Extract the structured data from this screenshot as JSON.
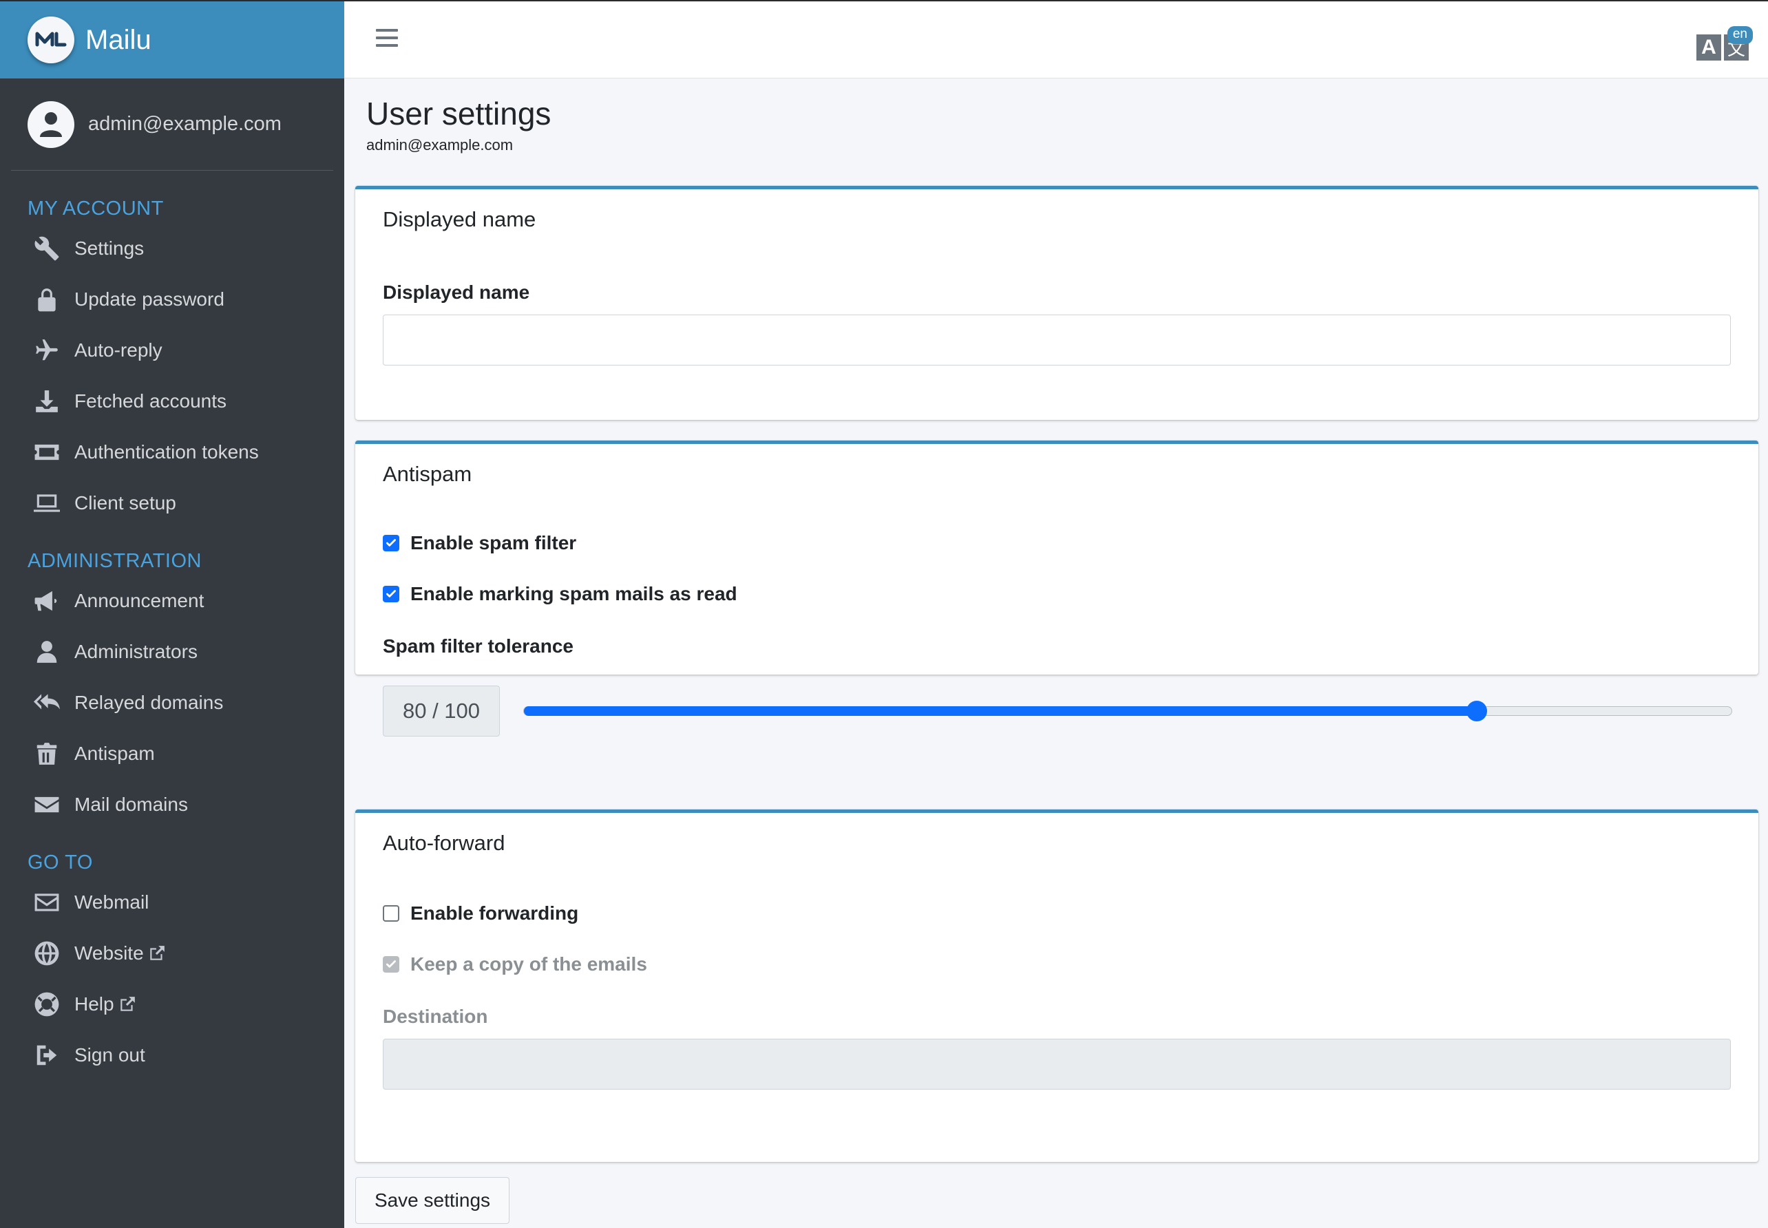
{
  "brand": {
    "name": "Mailu"
  },
  "user": {
    "email": "admin@example.com"
  },
  "sidebar": {
    "sections": [
      {
        "header": "MY ACCOUNT",
        "items": [
          {
            "label": "Settings",
            "icon": "wrench-icon"
          },
          {
            "label": "Update password",
            "icon": "lock-icon"
          },
          {
            "label": "Auto-reply",
            "icon": "plane-icon"
          },
          {
            "label": "Fetched accounts",
            "icon": "download-icon"
          },
          {
            "label": "Authentication tokens",
            "icon": "ticket-icon"
          },
          {
            "label": "Client setup",
            "icon": "laptop-icon"
          }
        ]
      },
      {
        "header": "ADMINISTRATION",
        "items": [
          {
            "label": "Announcement",
            "icon": "bullhorn-icon"
          },
          {
            "label": "Administrators",
            "icon": "user-icon"
          },
          {
            "label": "Relayed domains",
            "icon": "reply-all-icon"
          },
          {
            "label": "Antispam",
            "icon": "trash-icon"
          },
          {
            "label": "Mail domains",
            "icon": "envelope-icon"
          }
        ]
      },
      {
        "header": "GO TO",
        "items": [
          {
            "label": "Webmail",
            "icon": "envelope-outline-icon"
          },
          {
            "label": "Website",
            "icon": "globe-icon",
            "external": true
          },
          {
            "label": "Help",
            "icon": "lifebuoy-icon",
            "external": true
          },
          {
            "label": "Sign out",
            "icon": "sign-out-icon"
          }
        ]
      }
    ]
  },
  "topbar": {
    "language_badge": "en",
    "lang_a": "A",
    "lang_b": "文"
  },
  "page": {
    "title": "User settings",
    "subtitle": "admin@example.com"
  },
  "cards": {
    "displayed_name": {
      "title": "Displayed name",
      "label": "Displayed name",
      "value": ""
    },
    "antispam": {
      "title": "Antispam",
      "enable_spam_filter": {
        "label": "Enable spam filter",
        "checked": true
      },
      "mark_as_read": {
        "label": "Enable marking spam mails as read",
        "checked": true
      },
      "tolerance_label": "Spam filter tolerance",
      "tolerance_display": "80 / 100",
      "tolerance_value": 80,
      "tolerance_max": 100
    },
    "auto_forward": {
      "title": "Auto-forward",
      "enable_forwarding": {
        "label": "Enable forwarding",
        "checked": false
      },
      "keep_copy": {
        "label": "Keep a copy of the emails",
        "checked": true,
        "disabled": true
      },
      "destination_label": "Destination",
      "destination_value": ""
    }
  },
  "actions": {
    "save_label": "Save settings"
  },
  "colors": {
    "accent": "#3c8dbc",
    "sidebar_bg": "#343a40",
    "primary": "#0d6efd",
    "section_header": "#4aa3df"
  }
}
